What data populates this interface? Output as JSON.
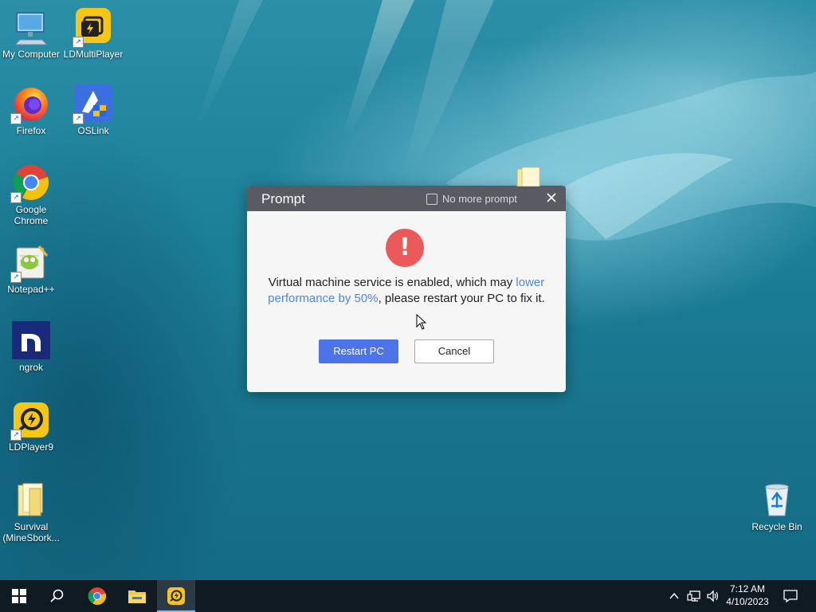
{
  "desktop": {
    "icons": [
      {
        "label": "My Computer",
        "icon": "computer-icon"
      },
      {
        "label": "LDMultiPlayer",
        "icon": "ldmultiplayer-icon"
      },
      {
        "label": "Firefox",
        "icon": "firefox-icon"
      },
      {
        "label": "OSLink",
        "icon": "oslink-icon"
      },
      {
        "label": "Google Chrome",
        "icon": "chrome-icon"
      },
      {
        "label": "Notepad++",
        "icon": "notepadpp-icon"
      },
      {
        "label": "ngrok",
        "icon": "ngrok-icon"
      },
      {
        "label": "LDPlayer9",
        "icon": "ldplayer-icon"
      },
      {
        "label": "Survival (MineSbork...",
        "icon": "folder-icon"
      },
      {
        "label": "Recycle Bin",
        "icon": "recycle-bin-icon"
      }
    ]
  },
  "dialog": {
    "title": "Prompt",
    "no_more_prompt": "No more prompt",
    "message_part1": "Virtual machine service is enabled, which may ",
    "message_highlight": "lower performance by 50%",
    "message_part2": ", please restart your PC to fix it.",
    "restart_label": "Restart PC",
    "cancel_label": "Cancel",
    "alert_symbol": "!"
  },
  "taskbar": {
    "time": "7:12 AM",
    "date": "4/10/2023",
    "apps": [
      "windows-start-icon",
      "search-icon",
      "chrome-icon",
      "file-explorer-icon",
      "ldplayer-icon"
    ]
  },
  "colors": {
    "accent": "#4c74e8",
    "highlight": "#4a86e8",
    "alert": "#eb5a5a",
    "titlebar": "#5a5a62"
  }
}
